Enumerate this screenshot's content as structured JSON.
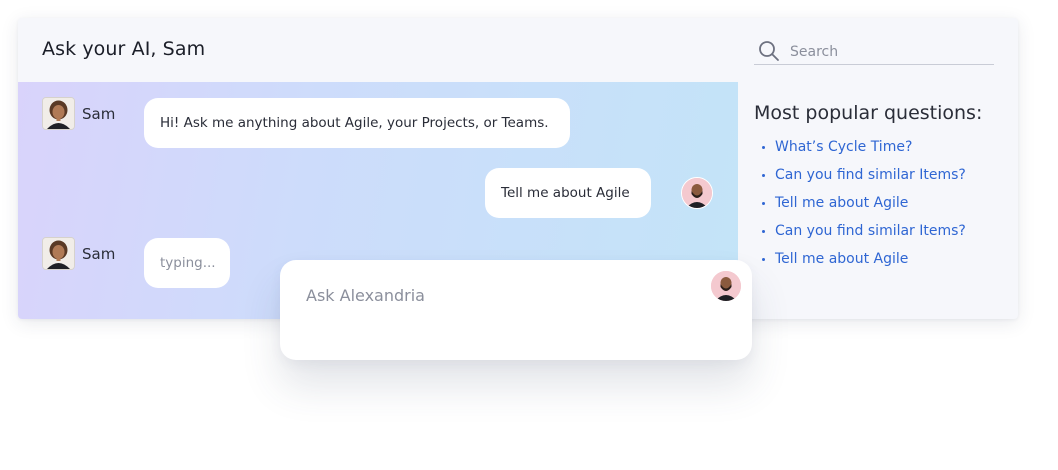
{
  "header": {
    "title": "Ask your AI, Sam",
    "search_placeholder": "Search",
    "search_icon": "search-icon"
  },
  "chat": {
    "messages": [
      {
        "sender": "Sam",
        "role": "assistant",
        "text": "Hi! Ask me anything about Agile, your Projects, or Teams."
      },
      {
        "sender": "",
        "role": "user",
        "text": "Tell me about Agile"
      },
      {
        "sender": "Sam",
        "role": "assistant",
        "text": "typing..."
      }
    ]
  },
  "sidebar": {
    "title": "Most popular questions:",
    "questions": [
      "What’s Cycle Time?",
      "Can you find similar Items?",
      "Tell me about Agile",
      "Can you find similar Items?",
      "Tell me about Agile"
    ]
  },
  "compose": {
    "placeholder": "Ask Alexandria"
  },
  "colors": {
    "link": "#2f66d3",
    "gradient_start": "#d9d3fb",
    "gradient_end": "#c3e4f8",
    "user_avatar_bg": "#f4c9cf"
  }
}
